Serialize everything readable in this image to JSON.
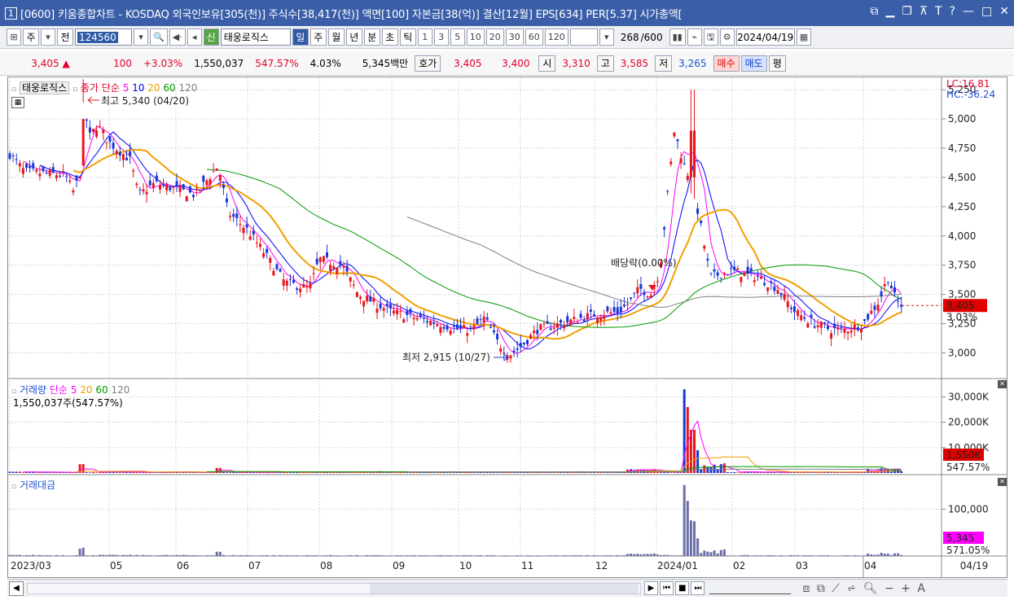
{
  "window": {
    "number": "1",
    "title": "[0600] 키움종합차트 - KOSDAQ 외국인보유[305(천)] 주식수[38,417(천)] 액면[100] 자본금[38(억)] 결산[12월] EPS[634] PER[5.37] 시가총액["
  },
  "toolbar": {
    "period_type": "주",
    "prev_label": "전",
    "code": "124560",
    "stock_badge": "신",
    "stock_name": "태웅로직스",
    "periods": [
      "일",
      "주",
      "월",
      "년",
      "분",
      "초",
      "틱"
    ],
    "selected_period": "일",
    "intervals": [
      "1",
      "3",
      "5",
      "10",
      "20",
      "30",
      "60",
      "120"
    ],
    "count": "268",
    "count_total": "/600",
    "date": "2024/04/19"
  },
  "quote": {
    "price": "3,405",
    "change_arrow": "▲",
    "change": "100",
    "change_pct": "+3.03%",
    "volume": "1,550,037",
    "volume_ratio": "547.57%",
    "turnover": "4.03%",
    "trade_value": "5,345백만",
    "hoga_label": "호가",
    "ask": "3,405",
    "bid": "3,400",
    "open_label": "시",
    "open": "3,310",
    "high_label": "고",
    "high": "3,585",
    "low_label": "저",
    "low": "3,265",
    "buy_label": "매수",
    "sell_label": "매도",
    "eval_label": "평"
  },
  "price_panel": {
    "name": "태웅로직스",
    "ma_label": "종가 단순",
    "ma_periods": [
      "5",
      "10",
      "20",
      "60",
      "120"
    ],
    "ma_colors": [
      "#ff00ff",
      "#0000ff",
      "#f0a000",
      "#009900",
      "#808080"
    ],
    "high_note": "최고 5,340 (04/20)",
    "low_note": "최저 2,915 (10/27)",
    "dividend_note": "배당락(0.00%)",
    "lc": "LC:16.81",
    "hc": "HC:-36.24",
    "current_price": "3,405",
    "current_pct": "3.03%",
    "y_ticks": [
      "5,250",
      "5,000",
      "4,750",
      "4,500",
      "4,250",
      "4,000",
      "3,750",
      "3,500",
      "3,250",
      "3,000"
    ]
  },
  "volume_panel": {
    "title": "거래량",
    "ma_label": "단순",
    "ma_periods": [
      "5",
      "20",
      "60",
      "120"
    ],
    "value_label": "1,550,037주(547.57%)",
    "y_ticks": [
      "30,000K",
      "20,000K",
      "10,000K"
    ],
    "current": "1,550K",
    "current_pct": "547.57%"
  },
  "amount_panel": {
    "title": "거래대금",
    "y_ticks": [
      "100,000"
    ],
    "current": "5,345",
    "current_pct": "571.05%"
  },
  "x_axis": {
    "labels": [
      "2023/03",
      "05",
      "06",
      "07",
      "08",
      "09",
      "10",
      "11",
      "12",
      "2024/01",
      "02",
      "03",
      "04"
    ],
    "right_label": "04/19"
  },
  "chart_data": {
    "type": "candlestick",
    "title": "태웅로직스",
    "x_range": [
      "2023/03",
      "2024/04/19"
    ],
    "y_range": [
      2850,
      5300
    ],
    "close_approx": [
      {
        "x": "2023/03",
        "y": 4700
      },
      {
        "x": "2023/04",
        "y": 4450
      },
      {
        "x": "2023/04/20",
        "y": 5200
      },
      {
        "x": "2023/05",
        "y": 4800
      },
      {
        "x": "2023/06",
        "y": 4350
      },
      {
        "x": "2023/07",
        "y": 4000
      },
      {
        "x": "2023/08",
        "y": 3800
      },
      {
        "x": "2023/09",
        "y": 3500
      },
      {
        "x": "2023/10",
        "y": 3250
      },
      {
        "x": "2023/10/27",
        "y": 2950
      },
      {
        "x": "2023/11",
        "y": 3200
      },
      {
        "x": "2023/12",
        "y": 3450
      },
      {
        "x": "2024/01",
        "y": 4800
      },
      {
        "x": "2024/02",
        "y": 3650
      },
      {
        "x": "2024/03",
        "y": 3250
      },
      {
        "x": "2024/04/19",
        "y": 3405
      }
    ],
    "legend": "top-left",
    "grid": true
  }
}
